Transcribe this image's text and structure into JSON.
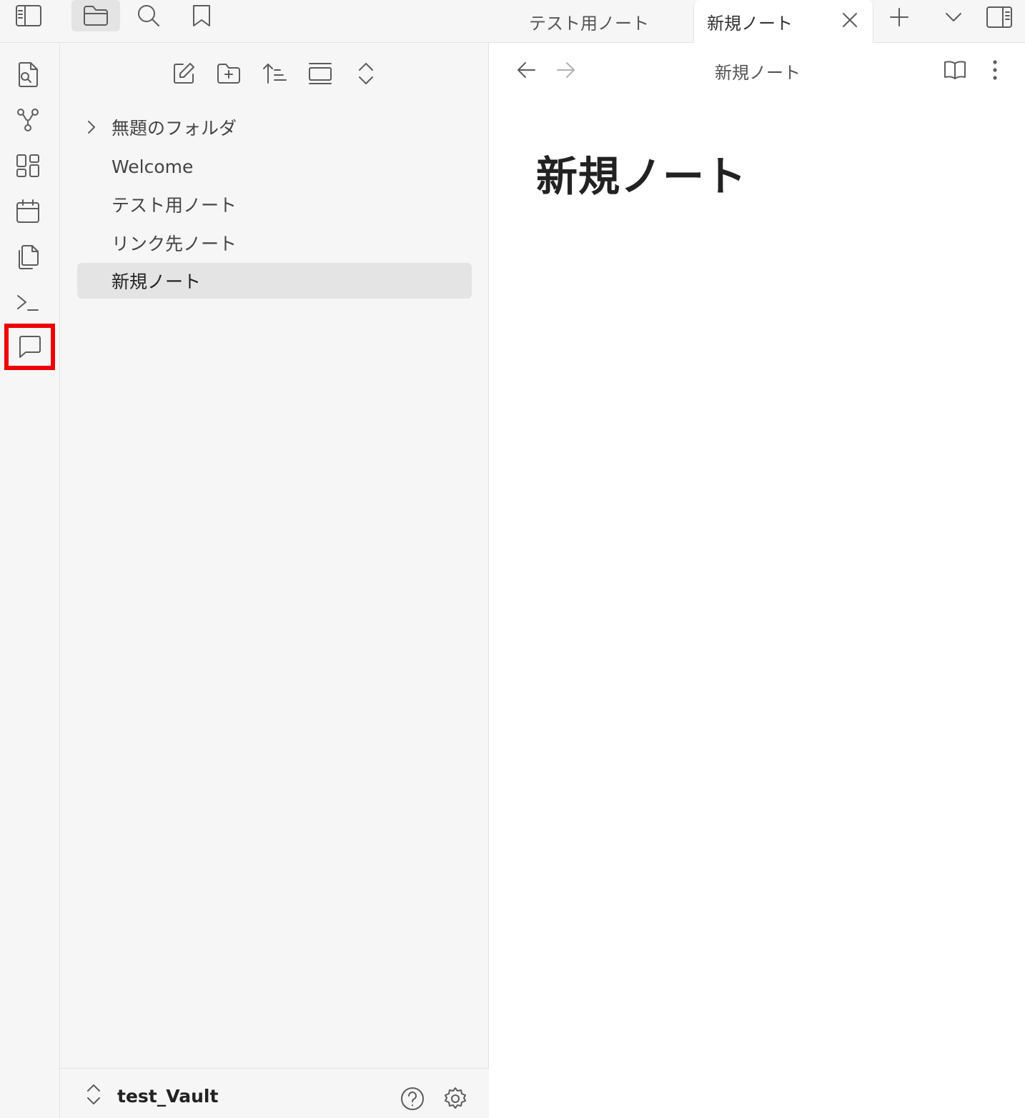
{
  "left_toolbar": {
    "buttons": [
      "sidebar-toggle-icon",
      "folder-icon",
      "search-icon",
      "bookmark-icon"
    ]
  },
  "ribbon": {
    "items": [
      "quick-switch-icon",
      "graph-icon",
      "canvas-icon",
      "calendar-icon",
      "copy-icon",
      "terminal-icon",
      "chat-icon"
    ],
    "highlighted": "chat-icon",
    "highlight_color": "#ee0000"
  },
  "explorer": {
    "toolbar": [
      "new-note-icon",
      "new-folder-icon",
      "sort-icon",
      "collapse-icon",
      "expand-icon"
    ],
    "items": [
      {
        "label": "無題のフォルダ",
        "type": "folder"
      },
      {
        "label": "Welcome",
        "type": "file"
      },
      {
        "label": "テスト用ノート",
        "type": "file"
      },
      {
        "label": "リンク先ノート",
        "type": "file"
      },
      {
        "label": "新規ノート",
        "type": "file",
        "active": true
      }
    ],
    "vault_name": "test_Vault"
  },
  "tabs": [
    {
      "label": "テスト用ノート",
      "active": false
    },
    {
      "label": "新規ノート",
      "active": true
    }
  ],
  "editor": {
    "view_title": "新規ノート",
    "note_title": "新規ノート"
  }
}
